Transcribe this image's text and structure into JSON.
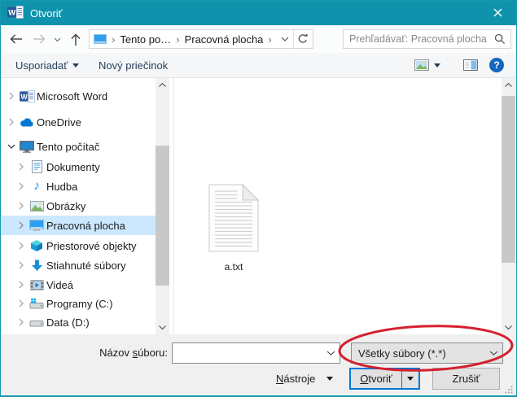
{
  "window": {
    "title": "Otvoriť",
    "accent_color": "#0f93ac"
  },
  "navbar": {
    "breadcrumb": {
      "separator": "›",
      "items": [
        "Tento po…",
        "Pracovná plocha"
      ]
    },
    "search": {
      "placeholder": "Prehľadávať: Pracovná plocha"
    }
  },
  "toolbar": {
    "organize_label": "Usporiadať",
    "new_folder_label": "Nový priečinok",
    "help_label": "?"
  },
  "sidebar": {
    "items": [
      {
        "label": "Microsoft Word",
        "icon": "word-icon",
        "level": 0,
        "expanded": false,
        "selected": false
      },
      {
        "label": "OneDrive",
        "icon": "onedrive-icon",
        "level": 0,
        "expanded": false,
        "selected": false
      },
      {
        "label": "Tento počítač",
        "icon": "computer-icon",
        "level": 0,
        "expanded": true,
        "selected": false
      },
      {
        "label": "Dokumenty",
        "icon": "documents-icon",
        "level": 1,
        "expanded": false,
        "selected": false
      },
      {
        "label": "Hudba",
        "icon": "music-icon",
        "level": 1,
        "expanded": false,
        "selected": false
      },
      {
        "label": "Obrázky",
        "icon": "pictures-icon",
        "level": 1,
        "expanded": false,
        "selected": false
      },
      {
        "label": "Pracovná plocha",
        "icon": "desktop-icon",
        "level": 1,
        "expanded": false,
        "selected": true
      },
      {
        "label": "Priestorové objekty",
        "icon": "3d-objects-icon",
        "level": 1,
        "expanded": false,
        "selected": false
      },
      {
        "label": "Stiahnuté súbory",
        "icon": "downloads-icon",
        "level": 1,
        "expanded": false,
        "selected": false
      },
      {
        "label": "Videá",
        "icon": "videos-icon",
        "level": 1,
        "expanded": false,
        "selected": false
      },
      {
        "label": "Programy (C:)",
        "icon": "drive-c-icon",
        "level": 1,
        "expanded": false,
        "selected": false
      },
      {
        "label": "Data (D:)",
        "icon": "drive-d-icon",
        "level": 1,
        "expanded": false,
        "selected": false
      }
    ]
  },
  "main": {
    "files": [
      {
        "name": "a.txt",
        "icon": "text-file-icon"
      }
    ]
  },
  "bottom": {
    "filename_label": {
      "pre": "Názov ",
      "mnemonic": "s",
      "post": "úboru:"
    },
    "filename_value": "",
    "filetype_value": "Všetky súbory (*.*)",
    "tools_button": {
      "mnemonic": "N",
      "post": "ástroje"
    },
    "open_button": {
      "mnemonic": "O",
      "post": "tvoriť"
    },
    "cancel_button": "Zrušiť"
  },
  "annotation": {
    "shape": "ellipse",
    "color": "#d5202e",
    "target": "filetype-combobox"
  }
}
